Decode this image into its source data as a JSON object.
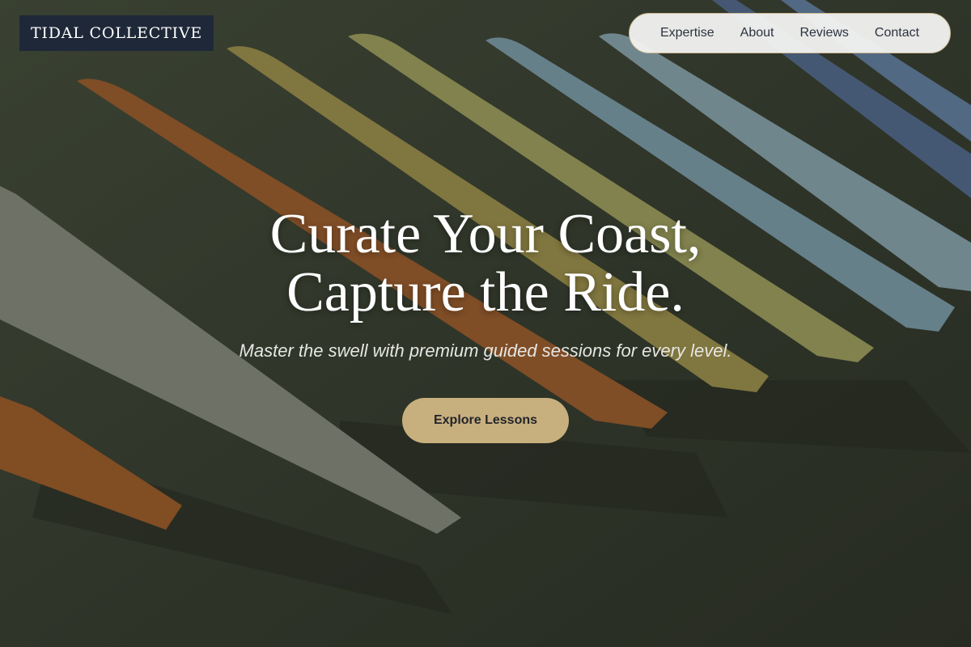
{
  "brand": {
    "logo_text": "TIDAL COLLECTIVE"
  },
  "nav": {
    "items": [
      {
        "label": "Expertise"
      },
      {
        "label": "About"
      },
      {
        "label": "Reviews"
      },
      {
        "label": "Contact"
      }
    ]
  },
  "hero": {
    "headline_line1": "Curate Your Coast,",
    "headline_line2": "Capture the Ride.",
    "subtitle": "Master the swell with premium guided sessions for every level.",
    "cta_label": "Explore Lessons",
    "background_image": "surfboards lying in a row on grass"
  },
  "colors": {
    "logo_bg": "#1e2838",
    "nav_bg": "#f3f3f1",
    "nav_border": "#cdb991",
    "cta_bg": "#c8b07e",
    "text_light": "#ffffff"
  }
}
